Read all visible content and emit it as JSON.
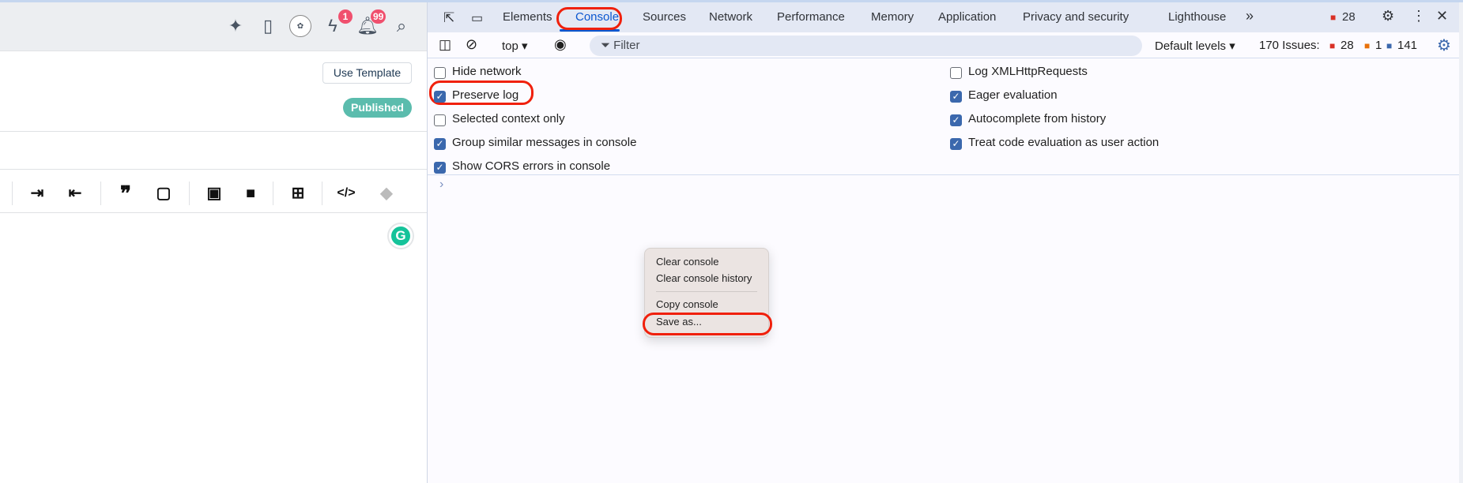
{
  "page": {
    "header_icons": [
      {
        "name": "sparkle-icon"
      },
      {
        "name": "document-icon"
      },
      {
        "name": "avatar"
      },
      {
        "name": "chat-bolt-icon",
        "badge": "1"
      },
      {
        "name": "bell-icon",
        "badge": "99"
      },
      {
        "name": "search-icon"
      }
    ],
    "use_template": "Use Template",
    "status": "Published",
    "status_color": "#5bbcad",
    "grammarly": "G"
  },
  "devtools": {
    "tabs": [
      "Elements",
      "Console",
      "Sources",
      "Network",
      "Performance",
      "Memory",
      "Application",
      "Privacy and security",
      "Lighthouse"
    ],
    "active_tab": "Console",
    "more_tabs": "»",
    "error_count": "28",
    "toolbar": {
      "context": "top ▾",
      "filter_placeholder": "Filter",
      "levels": "Default levels ▾",
      "issues_label": "170 Issues:",
      "issues_errors": "28",
      "issues_warnings": "1",
      "issues_info": "141"
    },
    "settings_left": [
      {
        "label": "Hide network",
        "checked": false
      },
      {
        "label": "Preserve log",
        "checked": true
      },
      {
        "label": "Selected context only",
        "checked": false
      },
      {
        "label": "Group similar messages in console",
        "checked": true
      },
      {
        "label": "Show CORS errors in console",
        "checked": true
      }
    ],
    "settings_right": [
      {
        "label": "Log XMLHttpRequests",
        "checked": false
      },
      {
        "label": "Eager evaluation",
        "checked": true
      },
      {
        "label": "Autocomplete from history",
        "checked": true
      },
      {
        "label": "Treat code evaluation as user action",
        "checked": true
      }
    ],
    "prompt": "›",
    "context_menu": [
      "Clear console",
      "Clear console history",
      "Copy console",
      "Save as..."
    ],
    "highlight_color": "#f0200c"
  }
}
